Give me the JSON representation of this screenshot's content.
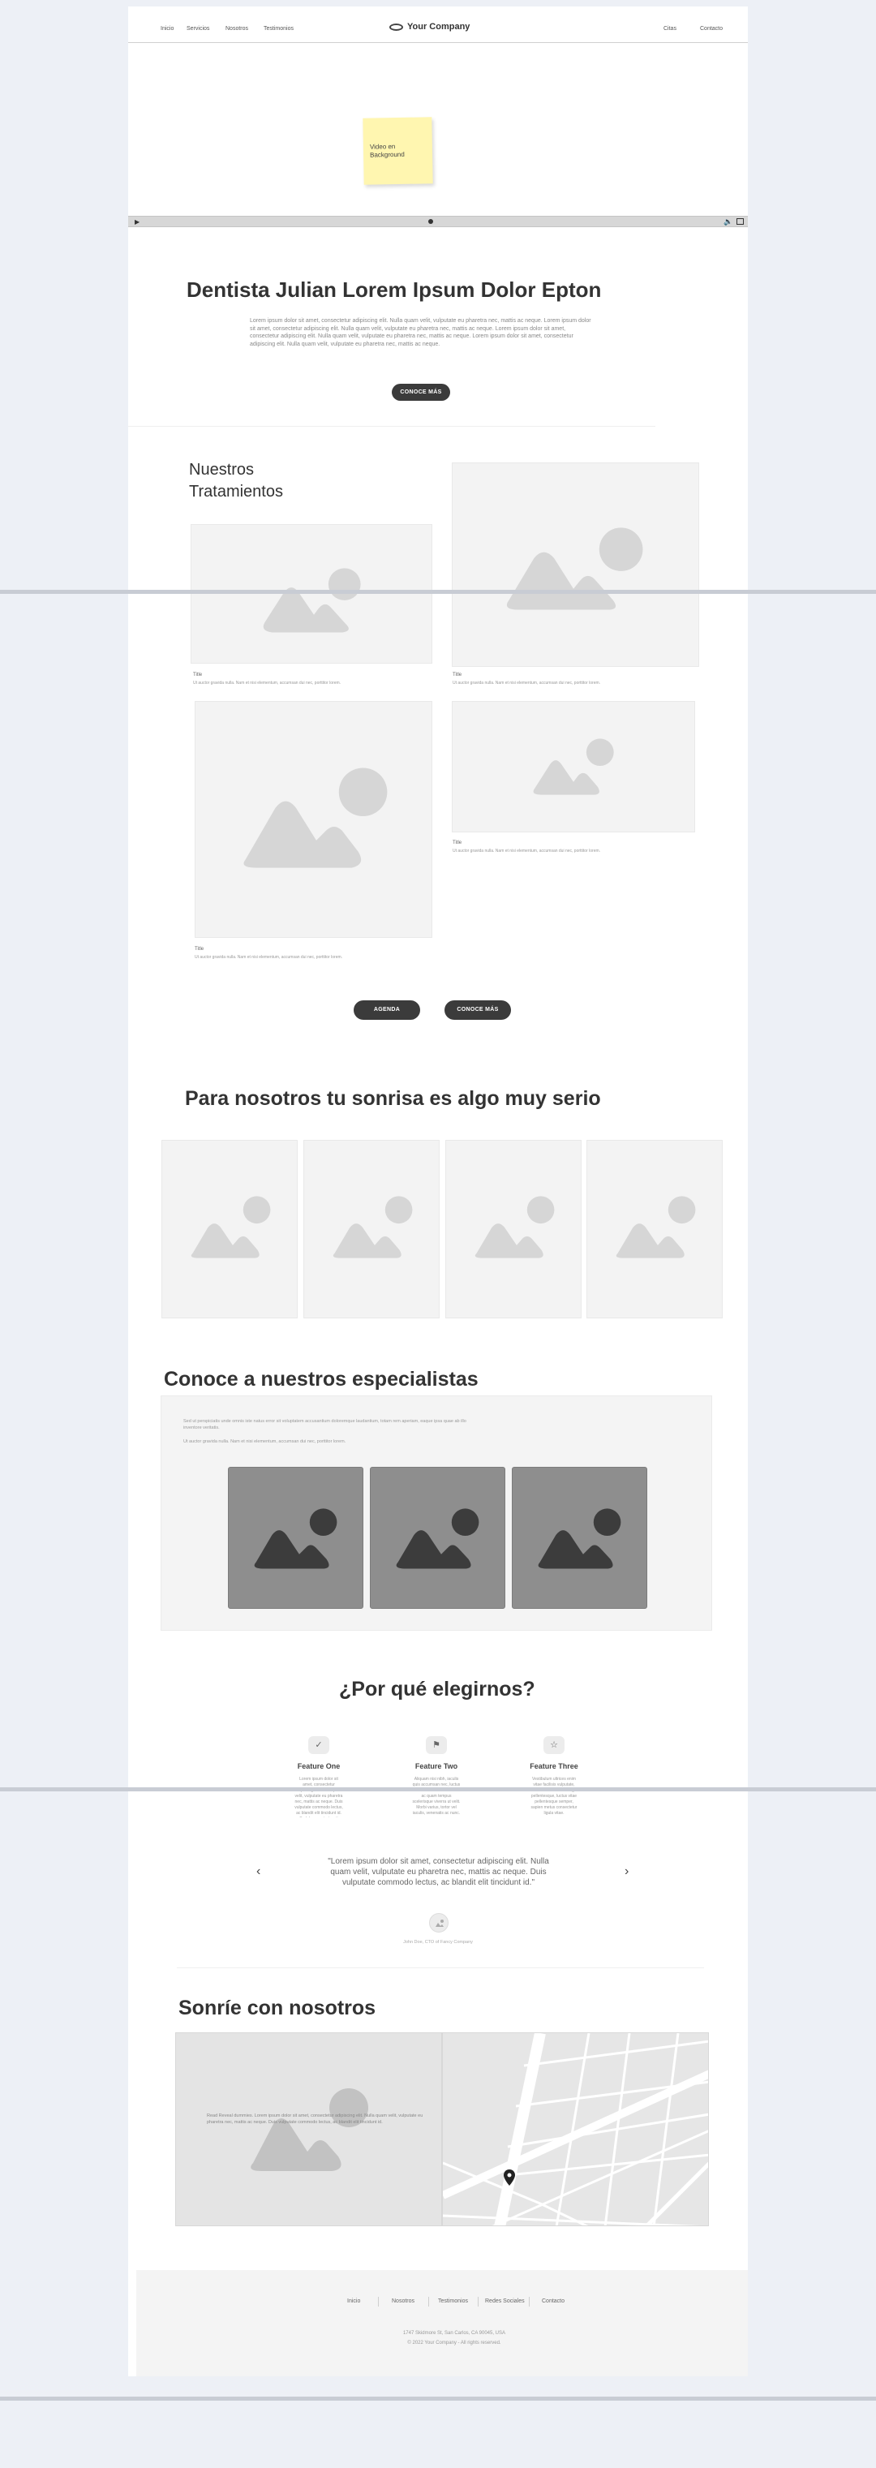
{
  "header": {
    "nav_left": [
      "Inicio",
      "Servicios",
      "Nosotros",
      "Testimonios"
    ],
    "brand": "Your Company",
    "nav_right": [
      "Citas",
      "Contacto"
    ]
  },
  "hero": {
    "note": "Video en Background"
  },
  "intro": {
    "title": "Dentista Julian Lorem Ipsum Dolor Epton",
    "body": "Lorem ipsum dolor sit amet, consectetur adipiscing elit. Nulla quam velit, vulputate eu pharetra nec, mattis ac neque. Lorem ipsum dolor sit amet, consectetur adipiscing elit. Nulla quam velit, vulputate eu pharetra nec, mattis ac neque. Lorem ipsum dolor sit amet, consectetur adipiscing elit. Nulla quam velit, vulputate eu pharetra nec, mattis ac neque. Lorem ipsum dolor sit amet, consectetur adipiscing elit. Nulla quam velit, vulputate eu pharetra nec, mattis ac neque.",
    "button": "CONOCE MÁS"
  },
  "treatments": {
    "title_line1": "Nuestros",
    "title_line2": "Tratamientos",
    "items": [
      {
        "title": "Title",
        "text": "Ut auctor gravida nulla. Nam et nisi elementum, accumsan dui nec, porttitor lorem."
      },
      {
        "title": "Title",
        "text": "Ut auctor gravida nulla. Nam et nisi elementum, accumsan dui nec, porttitor lorem."
      },
      {
        "title": "Title",
        "text": "Ut auctor gravida nulla. Nam et nisi elementum, accumsan dui nec, porttitor lorem."
      },
      {
        "title": "Title",
        "text": "Ut auctor gravida nulla. Nam et nisi elementum, accumsan dui nec, porttitor lorem."
      }
    ],
    "button_left": "AGENDA",
    "button_right": "CONOCE MÁS"
  },
  "smile": {
    "title": "Para nosotros tu sonrisa es algo muy serio"
  },
  "specialists": {
    "title": "Conoce a nuestros especialistas",
    "text1": "Sed ut perspiciatis unde omnis iste natus error sit voluptatem accusantium doloremque laudantium, totam rem aperiam, eaque ipsa quae ab illo inventore veritatis.",
    "text2": "Ut auctor gravida nulla. Nam et nisi elementum, accumsan dui nec, porttitor lorem."
  },
  "why": {
    "title": "¿Por qué elegirnos?",
    "features": [
      {
        "icon": "check-icon",
        "title": "Feature One",
        "text": "Lorem ipsum dolor sit amet, consectetur adipiscing elit. Nulla quam velit, vulputate eu pharetra nec, mattis ac neque. Duis vulputate commodo lectus, ac blandit elit tincidunt id. Sed rhoncus tortor sit amet, scelerisque gravida nulla."
      },
      {
        "icon": "flag-icon",
        "title": "Feature Two",
        "text": "Aliquam nisi nibh, iaculis quis accumsan nec, luctus nec dolor. Sed vitae lectus ac quam tempus scelerisque viverra ut velit. Morbi varius, tortor vel iaculis, venenatis ac nunc."
      },
      {
        "icon": "star-icon",
        "title": "Feature Three",
        "text": "Vestibulum ultrices enim vitae facilisis vulputate, sed finibus mauris. Integer pellentesque, luctus vitae pellentesque semper, sapien metus consectetur ligula vitae."
      }
    ]
  },
  "testimonial": {
    "quote": "\"Lorem ipsum dolor sit amet, consectetur adipiscing elit. Nulla quam velit, vulputate eu pharetra nec, mattis ac neque. Duis vulputate commodo lectus, ac blandit elit tincidunt id.\"",
    "author": "John Doe, CTO of Fancy Company",
    "prev": "‹",
    "next": "›"
  },
  "contact": {
    "title": "Sonríe con nosotros",
    "text": "Read Reveal dummies. Lorem ipsum dolor sit amet, consectetur adipiscing elit. Nulla quam velit, vulputate eu pharetra nec, mattis ac neque. Duis vulputate commodo lectus, ac blandit elit tincidunt id."
  },
  "footer": {
    "links": [
      "Inicio",
      "Nosotros",
      "Testimonios",
      "Redes Sociales",
      "Contacto"
    ],
    "address": "1747 Skidmore St, San Carlos, CA 90045, USA",
    "copyright": "© 2022 Your Company - All rights reserved."
  },
  "colors": {
    "page": "#ffffff",
    "background": "#edf0f6",
    "button": "#3b3b3b",
    "sticky": "#fff6b0"
  }
}
